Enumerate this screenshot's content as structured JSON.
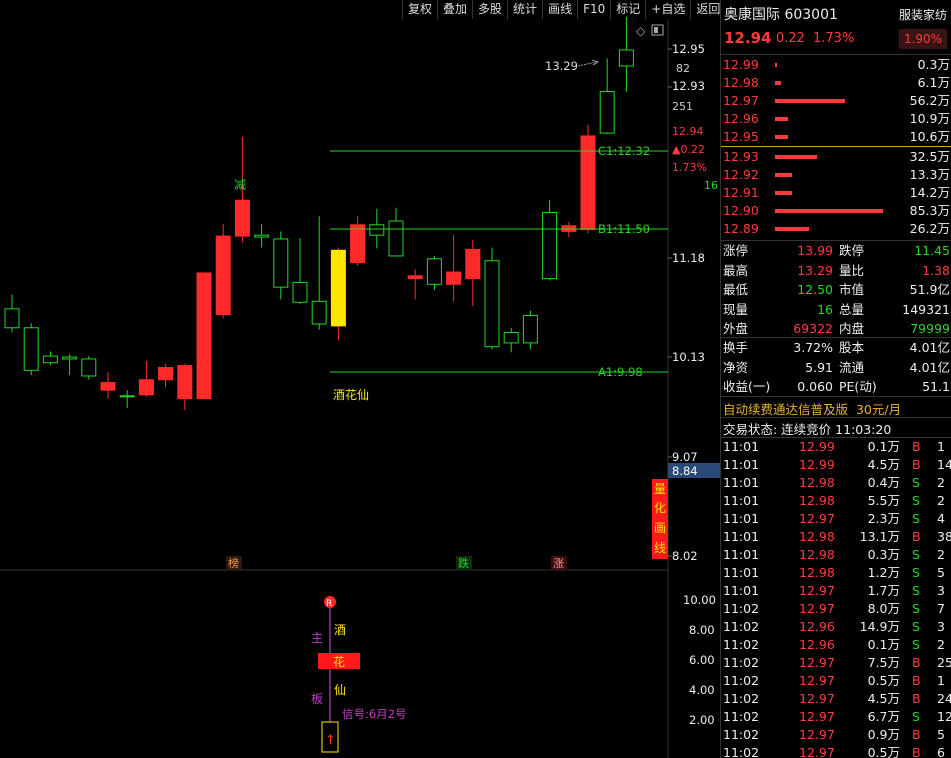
{
  "toolbar": [
    "复权",
    "叠加",
    "多股",
    "统计",
    "画线",
    "F10",
    "标记",
    "+自选",
    "返回"
  ],
  "stock": {
    "name": "奥康国际",
    "code": "603001",
    "price": "12.94",
    "change": "0.22",
    "pct": "1.73%",
    "industry": "服装家纺",
    "industry_pct": "1.90%"
  },
  "right_axis": {
    "price_labels": [
      {
        "t": "12.95"
      },
      {
        "t": "12.93"
      },
      {
        "t": "11.18"
      },
      {
        "t": "10.13"
      },
      {
        "t": "9.07"
      },
      {
        "t": "8.02"
      }
    ],
    "vol_labels": [
      {
        "t": "82"
      },
      {
        "t": "251"
      }
    ],
    "mini": [
      {
        "t": "12.94",
        "c": "red"
      },
      {
        "t": "▲0.22",
        "c": "red"
      },
      {
        "t": "1.73%",
        "c": "red"
      },
      {
        "t": "16",
        "c": "green"
      }
    ],
    "current": "8.84",
    "lower": [
      "10.00",
      "8.00",
      "6.00",
      "4.00",
      "2.00"
    ]
  },
  "annotations": {
    "high": "13.29",
    "c1": "C1:12.32",
    "b1": "B1:11.50",
    "a1": "A1:9.98",
    "jian": "减",
    "jiuhuaxian": "酒花仙",
    "bottom_tags": [
      "榜",
      "跌",
      "涨"
    ],
    "lianghua": [
      "量",
      "化",
      "画",
      "线"
    ],
    "lower_r": "R",
    "lower_left": [
      "主",
      "板"
    ],
    "lower_right": [
      "酒",
      "仙"
    ],
    "lower_box": "花",
    "signal": "信号:6月2号",
    "arrow": "↑"
  },
  "chart_data": {
    "type": "candlestick",
    "candles": [
      {
        "o": 10.2,
        "c": 10.0,
        "h": 10.35,
        "l": 9.95
      },
      {
        "o": 10.0,
        "c": 9.55,
        "h": 10.05,
        "l": 9.5
      },
      {
        "o": 9.7,
        "c": 9.63,
        "h": 9.75,
        "l": 9.6
      },
      {
        "o": 9.69,
        "c": 9.67,
        "h": 9.72,
        "l": 9.5
      },
      {
        "o": 9.67,
        "c": 9.49,
        "h": 9.7,
        "l": 9.45
      },
      {
        "o": 9.34,
        "c": 9.42,
        "h": 9.53,
        "l": 9.25
      },
      {
        "o": 9.28,
        "c": 9.27,
        "h": 9.34,
        "l": 9.15
      },
      {
        "o": 9.29,
        "c": 9.45,
        "h": 9.65,
        "l": 9.27
      },
      {
        "o": 9.45,
        "c": 9.58,
        "h": 9.62,
        "l": 9.37
      },
      {
        "o": 9.25,
        "c": 9.6,
        "h": 9.62,
        "l": 9.13
      },
      {
        "o": 9.25,
        "c": 10.58,
        "h": 10.58,
        "l": 9.25
      },
      {
        "o": 10.14,
        "c": 10.97,
        "h": 11.1,
        "l": 10.1
      },
      {
        "o": 10.97,
        "c": 11.35,
        "h": 12.02,
        "l": 10.9
      },
      {
        "o": 10.98,
        "c": 10.96,
        "h": 11.1,
        "l": 10.85
      },
      {
        "o": 10.94,
        "c": 10.43,
        "h": 11.02,
        "l": 10.3
      },
      {
        "o": 10.48,
        "c": 10.27,
        "h": 10.95,
        "l": 10.25
      },
      {
        "o": 10.28,
        "c": 10.04,
        "h": 11.18,
        "l": 9.98
      },
      {
        "o": 10.02,
        "c": 10.82,
        "h": 10.85,
        "l": 9.87
      },
      {
        "o": 10.69,
        "c": 11.09,
        "h": 11.18,
        "l": 10.66
      },
      {
        "o": 11.09,
        "c": 10.98,
        "h": 11.26,
        "l": 10.84
      },
      {
        "o": 11.13,
        "c": 10.76,
        "h": 11.27,
        "l": 10.76
      },
      {
        "o": 10.52,
        "c": 10.55,
        "h": 10.62,
        "l": 10.3
      },
      {
        "o": 10.73,
        "c": 10.46,
        "h": 10.76,
        "l": 10.4
      },
      {
        "o": 10.46,
        "c": 10.59,
        "h": 10.98,
        "l": 10.28
      },
      {
        "o": 10.52,
        "c": 10.83,
        "h": 10.93,
        "l": 10.23
      },
      {
        "o": 10.71,
        "c": 9.8,
        "h": 10.85,
        "l": 9.77
      },
      {
        "o": 9.95,
        "c": 9.84,
        "h": 10.0,
        "l": 9.74
      },
      {
        "o": 10.13,
        "c": 9.84,
        "h": 10.18,
        "l": 9.77
      },
      {
        "o": 11.22,
        "c": 10.52,
        "h": 11.35,
        "l": 10.5
      },
      {
        "o": 11.02,
        "c": 11.08,
        "h": 11.12,
        "l": 10.96
      },
      {
        "o": 11.04,
        "c": 12.03,
        "h": 12.15,
        "l": 11.0
      },
      {
        "o": 12.5,
        "c": 12.06,
        "h": 12.85,
        "l": 12.05
      },
      {
        "o": 12.94,
        "c": 12.77,
        "h": 13.29,
        "l": 12.5
      }
    ]
  },
  "order_book": {
    "asks": [
      {
        "p": "12.99",
        "v": "0.3万",
        "w": 2
      },
      {
        "p": "12.98",
        "v": "6.1万",
        "w": 6
      },
      {
        "p": "12.97",
        "v": "56.2万",
        "w": 70
      },
      {
        "p": "12.96",
        "v": "10.9万",
        "w": 13
      },
      {
        "p": "12.95",
        "v": "10.6万",
        "w": 13
      }
    ],
    "bids": [
      {
        "p": "12.93",
        "v": "32.5万",
        "w": 42
      },
      {
        "p": "12.92",
        "v": "13.3万",
        "w": 17
      },
      {
        "p": "12.91",
        "v": "14.2万",
        "w": 17
      },
      {
        "p": "12.90",
        "v": "85.3万",
        "w": 108
      },
      {
        "p": "12.89",
        "v": "26.2万",
        "w": 34
      }
    ]
  },
  "stats": [
    {
      "l1": "涨停",
      "v1": "13.99",
      "c1": "red",
      "l2": "跌停",
      "v2": "11.45",
      "c2": "green"
    },
    {
      "l1": "最高",
      "v1": "13.29",
      "c1": "red",
      "l2": "量比",
      "v2": "1.38",
      "c2": "red"
    },
    {
      "l1": "最低",
      "v1": "12.50",
      "c1": "green",
      "l2": "市值",
      "v2": "51.9亿",
      "c2": "white"
    },
    {
      "l1": "现量",
      "v1": "16",
      "c1": "green",
      "l2": "总量",
      "v2": "149321",
      "c2": "white"
    },
    {
      "l1": "外盘",
      "v1": "69322",
      "c1": "red",
      "l2": "内盘",
      "v2": "79999",
      "c2": "green"
    }
  ],
  "stats2": [
    {
      "l1": "换手",
      "v1": "3.72%",
      "c1": "white",
      "l2": "股本",
      "v2": "4.01亿",
      "c2": "white"
    },
    {
      "l1": "净资",
      "v1": "5.91",
      "c1": "white",
      "l2": "流通",
      "v2": "4.01亿",
      "c2": "white"
    },
    {
      "l1": "收益(一)",
      "v1": "0.060",
      "c1": "white",
      "l2": "PE(动)",
      "v2": "51.1",
      "c2": "white"
    }
  ],
  "promo": {
    "text": "自动续费通达信普及版",
    "price": "30元/月"
  },
  "trade_status": "交易状态: 连续竞价 11:03:20",
  "ticks": [
    {
      "t": "11:01",
      "p": "12.99",
      "v": "0.1万",
      "s": "B",
      "n": "1"
    },
    {
      "t": "11:01",
      "p": "12.99",
      "v": "4.5万",
      "s": "B",
      "n": "14"
    },
    {
      "t": "11:01",
      "p": "12.98",
      "v": "0.4万",
      "s": "S",
      "n": "2"
    },
    {
      "t": "11:01",
      "p": "12.98",
      "v": "5.5万",
      "s": "S",
      "n": "2"
    },
    {
      "t": "11:01",
      "p": "12.97",
      "v": "2.3万",
      "s": "S",
      "n": "4"
    },
    {
      "t": "11:01",
      "p": "12.98",
      "v": "13.1万",
      "s": "B",
      "n": "38"
    },
    {
      "t": "11:01",
      "p": "12.98",
      "v": "0.3万",
      "s": "S",
      "n": "2"
    },
    {
      "t": "11:01",
      "p": "12.98",
      "v": "1.2万",
      "s": "S",
      "n": "5"
    },
    {
      "t": "11:01",
      "p": "12.97",
      "v": "1.7万",
      "s": "S",
      "n": "3"
    },
    {
      "t": "11:02",
      "p": "12.97",
      "v": "8.0万",
      "s": "S",
      "n": "7"
    },
    {
      "t": "11:02",
      "p": "12.96",
      "v": "14.9万",
      "s": "S",
      "n": "3"
    },
    {
      "t": "11:02",
      "p": "12.96",
      "v": "0.1万",
      "s": "S",
      "n": "2"
    },
    {
      "t": "11:02",
      "p": "12.97",
      "v": "7.5万",
      "s": "B",
      "n": "25"
    },
    {
      "t": "11:02",
      "p": "12.97",
      "v": "0.5万",
      "s": "B",
      "n": "1"
    },
    {
      "t": "11:02",
      "p": "12.97",
      "v": "4.5万",
      "s": "B",
      "n": "24"
    },
    {
      "t": "11:02",
      "p": "12.97",
      "v": "6.7万",
      "s": "S",
      "n": "12"
    },
    {
      "t": "11:02",
      "p": "12.97",
      "v": "0.9万",
      "s": "B",
      "n": "5"
    },
    {
      "t": "11:02",
      "p": "12.97",
      "v": "0.5万",
      "s": "B",
      "n": "6"
    }
  ],
  "colors": {
    "up": "#ff2b2b",
    "down": "#22d922",
    "line": "#22d922",
    "accent": "#ffe600"
  }
}
